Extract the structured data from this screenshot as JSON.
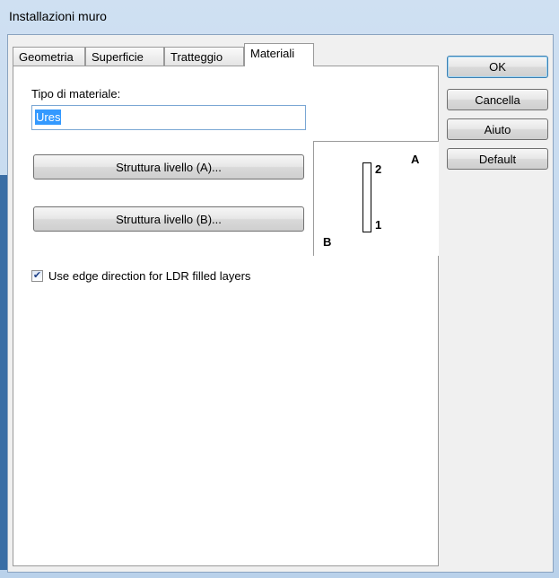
{
  "window": {
    "title": "Installazioni muro"
  },
  "tabs": [
    {
      "label": "Geometria"
    },
    {
      "label": "Superficie"
    },
    {
      "label": "Tratteggio"
    },
    {
      "label": "Materiali",
      "active": true
    }
  ],
  "materiali": {
    "material_type_label": "Tipo di materiale:",
    "material_type_value": "Ures",
    "structure_a_button": "Struttura livello (A)...",
    "structure_b_button": "Struttura livello (B)...",
    "preview": {
      "label_a": "A",
      "label_b": "B",
      "label_2": "2",
      "label_1": "1"
    },
    "edge_direction_checkbox": {
      "label": "Use edge direction for LDR filled layers",
      "checked": true
    }
  },
  "buttons": {
    "ok": "OK",
    "cancel": "Cancella",
    "help": "Aiuto",
    "default": "Default"
  },
  "icons": {
    "check": "✔"
  }
}
